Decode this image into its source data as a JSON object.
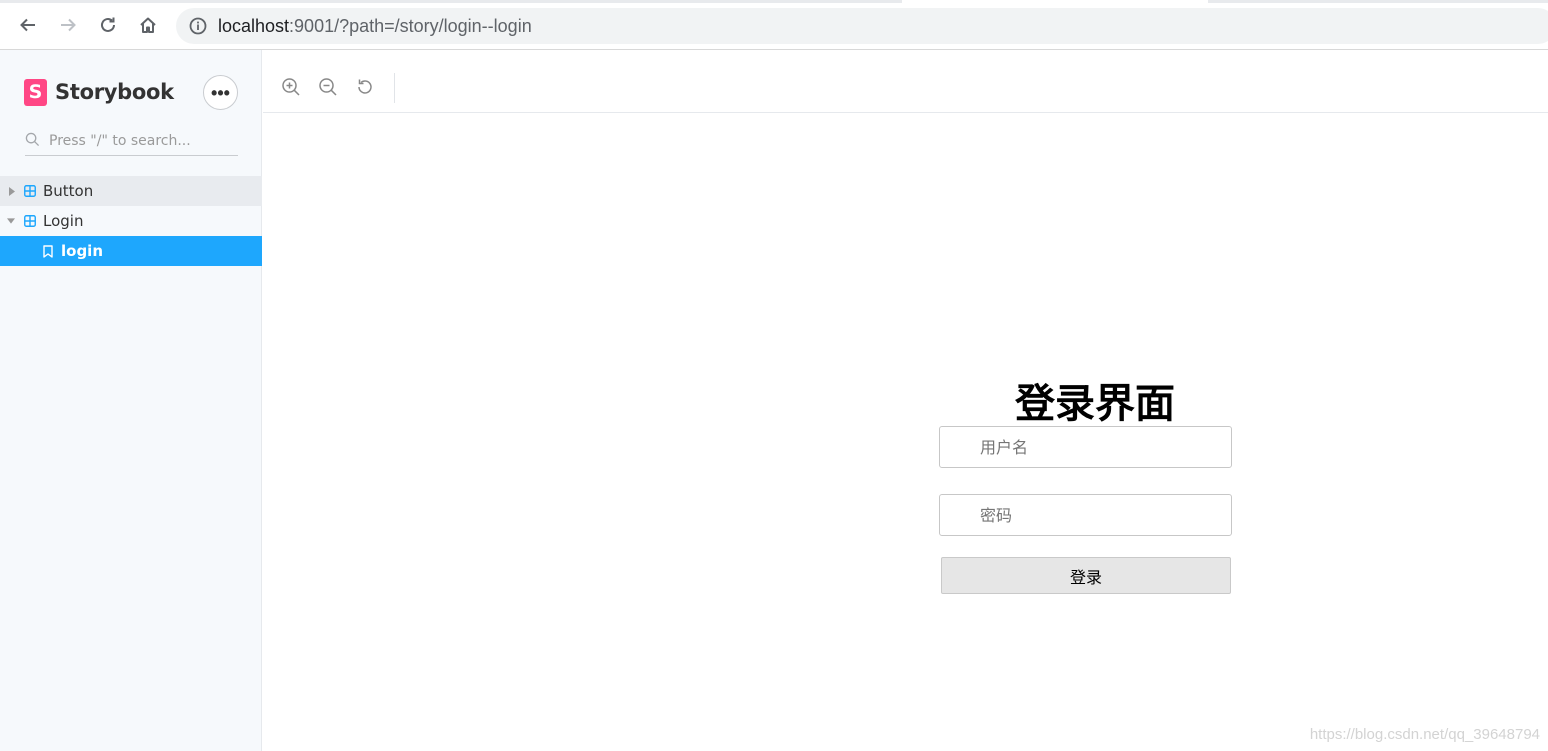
{
  "browser": {
    "url_host": "localhost",
    "url_rest": ":9001/?path=/story/login--login"
  },
  "sidebar": {
    "brand": "Storybook",
    "brand_logo_letter": "S",
    "menu_glyph": "•••",
    "search_placeholder": "Press \"/\" to search...",
    "items": [
      {
        "label": "Button",
        "type": "component",
        "expanded": false
      },
      {
        "label": "Login",
        "type": "component",
        "expanded": true
      },
      {
        "label": "login",
        "type": "story",
        "selected": true
      }
    ]
  },
  "story": {
    "title": "登录界面",
    "username_placeholder": "用户名",
    "password_placeholder": "密码",
    "submit_label": "登录"
  },
  "watermark": "https://blog.csdn.net/qq_39648794",
  "colors": {
    "brand_pink": "#ff4785",
    "selected_blue": "#1ea7fd",
    "sidebar_bg": "#f6f9fc"
  }
}
